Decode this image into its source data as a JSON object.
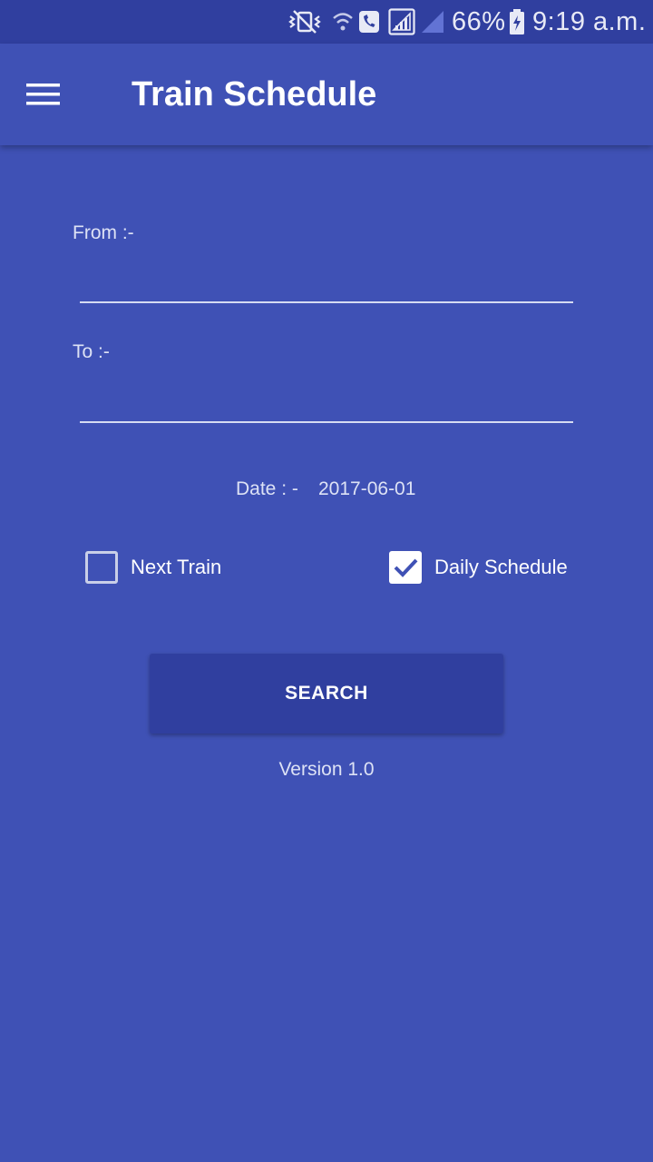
{
  "status_bar": {
    "battery_percent": "66%",
    "time": "9:19 a.m.",
    "icons": [
      "vibrate-mute-icon",
      "wifi-call-icon",
      "signal-icon",
      "signal-empty-icon",
      "battery-charging-icon"
    ]
  },
  "app_bar": {
    "title": "Train Schedule",
    "menu_icon": "hamburger-menu-icon"
  },
  "form": {
    "from_label": "From :-",
    "from_value": "",
    "to_label": "To :-",
    "to_value": "",
    "date_label": "Date : -",
    "date_value": "2017-06-01",
    "next_train": {
      "label": "Next Train",
      "checked": false
    },
    "daily_schedule": {
      "label": "Daily Schedule",
      "checked": true
    },
    "search_label": "SEARCH",
    "version": "Version 1.0"
  },
  "colors": {
    "primary": "#3f51b5",
    "primary_dark": "#303f9f",
    "text": "#ffffff"
  }
}
